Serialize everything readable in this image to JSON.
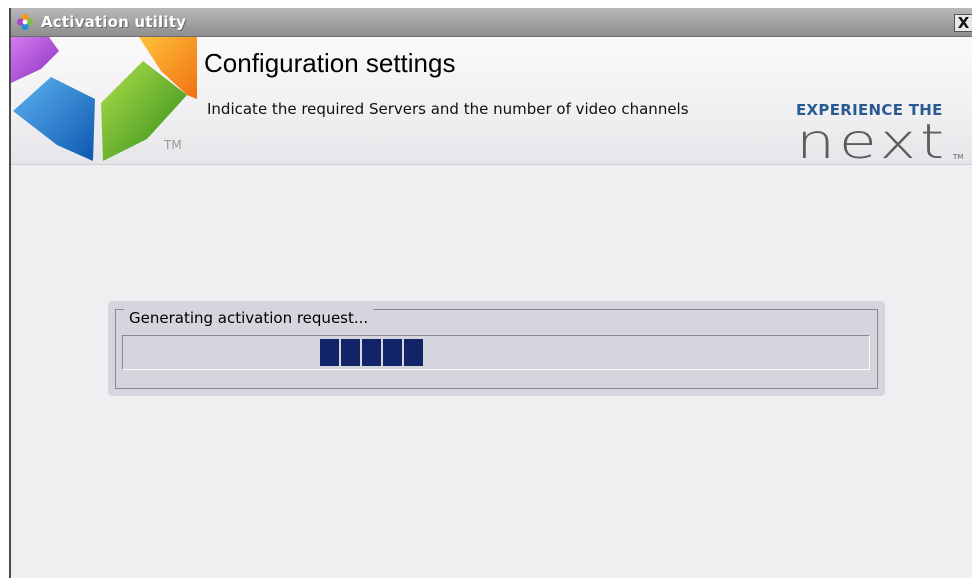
{
  "window": {
    "title": "Activation utility",
    "close_label": "X"
  },
  "header": {
    "title": "Configuration settings",
    "subtitle": "Indicate the required Servers and the number of video channels",
    "logo_mark": "TM",
    "brand_tagline": "EXPERIENCE THE",
    "brand_name": "next",
    "brand_mark": "TM"
  },
  "progress": {
    "label": "Generating activation request...",
    "state": "indeterminate (marquee)",
    "block_count": 5,
    "color": "#122468"
  },
  "colors": {
    "titlebar": "#a4a4a4",
    "background": "#efeff2",
    "brand": "#2a5a92",
    "progress_fill": "#122468"
  }
}
